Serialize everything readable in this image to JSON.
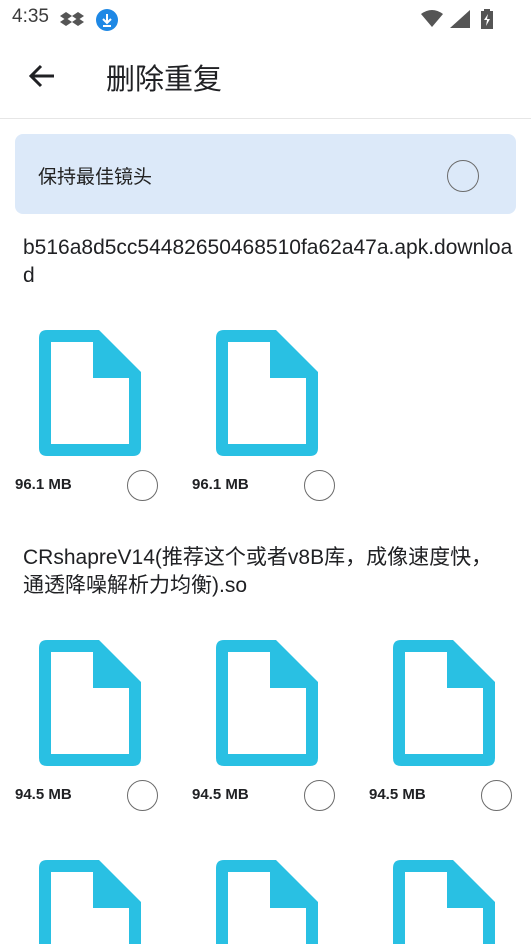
{
  "status_bar": {
    "time": "4:35",
    "left_icons": [
      "dropbox-icon",
      "download-icon"
    ],
    "right_icons": [
      "wifi-icon",
      "signal-icon",
      "battery-icon"
    ]
  },
  "app_bar": {
    "back_icon": "arrow-back-icon",
    "title": "删除重复"
  },
  "keep_best": {
    "label": "保持最佳镜头",
    "checked": false
  },
  "groups": [
    {
      "title": "b516a8d5cc54482650468510fa62a47a.apk.download",
      "files": [
        {
          "size": "96.1 MB",
          "checked": false
        },
        {
          "size": "96.1 MB",
          "checked": false
        }
      ]
    },
    {
      "title": "CRshapreV14(推荐这个或者v8B库，成像速度快，通透降噪解析力均衡).so",
      "files": [
        {
          "size": "94.5 MB",
          "checked": false
        },
        {
          "size": "94.5 MB",
          "checked": false
        },
        {
          "size": "94.5 MB",
          "checked": false
        }
      ]
    }
  ],
  "colors": {
    "file_icon": "#29c0e3",
    "keep_best_bg": "#dce9f9",
    "accent_download": "#1e88e5"
  }
}
